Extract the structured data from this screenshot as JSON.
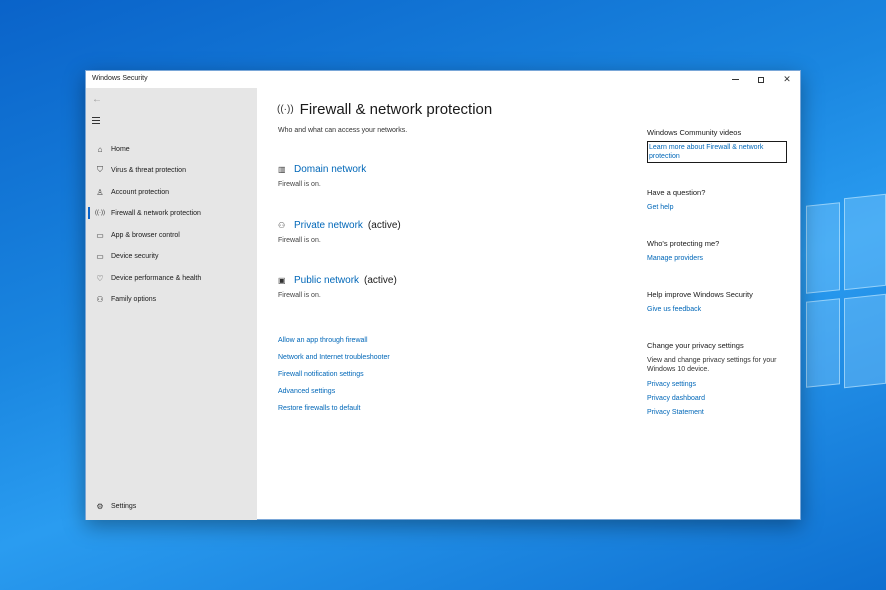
{
  "window": {
    "title": "Windows Security"
  },
  "sidebar": {
    "items": [
      {
        "label": "Home",
        "icon": "home-icon",
        "glyph": "⌂"
      },
      {
        "label": "Virus & threat protection",
        "icon": "shield-icon",
        "glyph": "⛉"
      },
      {
        "label": "Account protection",
        "icon": "person-icon",
        "glyph": "♙"
      },
      {
        "label": "Firewall & network protection",
        "icon": "wireless-icon",
        "glyph": "((·))"
      },
      {
        "label": "App & browser control",
        "icon": "app-window-icon",
        "glyph": "▭"
      },
      {
        "label": "Device security",
        "icon": "laptop-icon",
        "glyph": "▭"
      },
      {
        "label": "Device performance & health",
        "icon": "heart-icon",
        "glyph": "♡"
      },
      {
        "label": "Family options",
        "icon": "family-icon",
        "glyph": "⚇"
      }
    ],
    "settings_label": "Settings"
  },
  "main": {
    "title": "Firewall & network protection",
    "subtitle": "Who and what can access your networks.",
    "networks": [
      {
        "name": "Domain network",
        "active": "",
        "status": "Firewall is on.",
        "icon": "domain-network-icon",
        "glyph": "▥"
      },
      {
        "name": "Private network",
        "active": "(active)",
        "status": "Firewall is on.",
        "icon": "private-network-icon",
        "glyph": "⚇"
      },
      {
        "name": "Public network",
        "active": "(active)",
        "status": "Firewall is on.",
        "icon": "public-network-icon",
        "glyph": "▣"
      }
    ],
    "links": [
      "Allow an app through firewall",
      "Network and Internet troubleshooter",
      "Firewall notification settings",
      "Advanced settings",
      "Restore firewalls to default"
    ]
  },
  "right_panel": {
    "videos_heading": "Windows Community videos",
    "videos_link": "Learn more about Firewall & network protection",
    "question_heading": "Have a question?",
    "question_link": "Get help",
    "protecting_heading": "Who's protecting me?",
    "protecting_link": "Manage providers",
    "improve_heading": "Help improve Windows Security",
    "improve_link": "Give us feedback",
    "privacy_heading": "Change your privacy settings",
    "privacy_text": "View and change privacy settings for your Windows 10 device.",
    "privacy_links": [
      "Privacy settings",
      "Privacy dashboard",
      "Privacy Statement"
    ]
  }
}
